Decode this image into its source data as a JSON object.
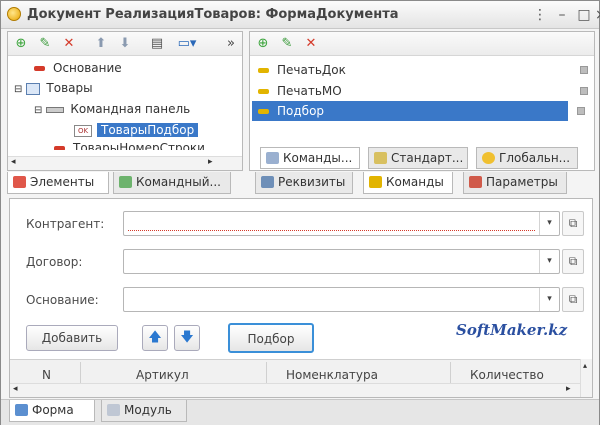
{
  "window": {
    "title": "Документ РеализацияТоваров: ФормаДокумента"
  },
  "tree": {
    "items": [
      {
        "label": "Основание"
      },
      {
        "label": "Товары"
      },
      {
        "label": "Командная панель"
      },
      {
        "label": "ТоварыПодбор",
        "badge": "OK"
      },
      {
        "label": "ТоварыНомерСтроки"
      }
    ]
  },
  "commands": {
    "items": [
      {
        "label": "ПечатьДок"
      },
      {
        "label": "ПечатьМО"
      },
      {
        "label": "Подбор"
      }
    ],
    "subtabs": [
      "Команды...",
      "Стандарт...",
      "Глобальн..."
    ]
  },
  "left_tabs": [
    "Элементы",
    "Командный..."
  ],
  "right_tabs": [
    "Реквизиты",
    "Команды",
    "Параметры"
  ],
  "form": {
    "fields": [
      {
        "label": "Контрагент:"
      },
      {
        "label": "Договор:"
      },
      {
        "label": "Основание:"
      }
    ],
    "add_button": "Добавить",
    "pick_button": "Подбор",
    "watermark": "SoftMaker.kz",
    "columns": [
      "N",
      "Артикул",
      "Номенклатура",
      "Количество"
    ]
  },
  "bottom_tabs": [
    "Форма",
    "Модуль"
  ],
  "colors": {
    "selection": "#3a78c8",
    "accent_red": "#d43a2a",
    "accent_yellow": "#e2b400",
    "add_green": "#3aa43a"
  }
}
